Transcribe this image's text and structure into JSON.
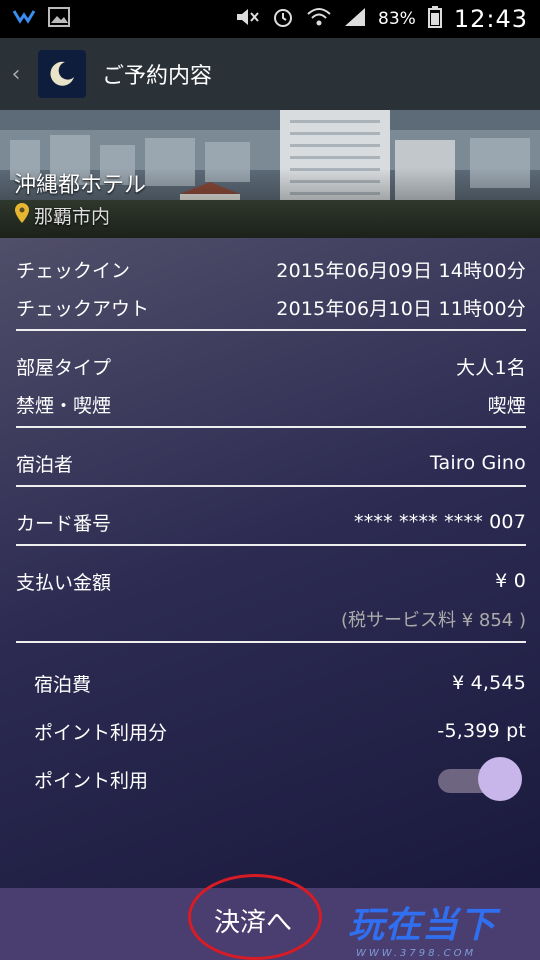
{
  "status_bar": {
    "battery": "83%",
    "time": "12:43"
  },
  "header": {
    "back_glyph": "‹",
    "title": "ご予約内容"
  },
  "hotel": {
    "name": "沖縄都ホテル",
    "location": "那覇市内"
  },
  "booking": {
    "checkin_label": "チェックイン",
    "checkin_value": "2015年06月09日 14時00分",
    "checkout_label": "チェックアウト",
    "checkout_value": "2015年06月10日 11時00分",
    "room_type_label": "部屋タイプ",
    "room_type_value": "大人1名",
    "smoking_label": "禁煙・喫煙",
    "smoking_value": "喫煙",
    "guest_label": "宿泊者",
    "guest_value": "Tairo Gino",
    "card_label": "カード番号",
    "card_value": "**** **** **** 007",
    "payment_label": "支払い金額",
    "payment_value": "¥ 0",
    "tax_note": "(税サービス料 ¥ 854 )",
    "lodging_fee_label": "宿泊費",
    "lodging_fee_value": "¥ 4,545",
    "points_used_label": "ポイント利用分",
    "points_used_value": "-5,399 pt",
    "use_points_label": "ポイント利用"
  },
  "footer": {
    "pay_button_label": "決済へ"
  },
  "watermark": {
    "main": "玩在当下",
    "sub": "WWW.3798.COM"
  },
  "colors": {
    "accent": "#c8b6ea",
    "footer": "#4a3d6f",
    "mark": "#d81b24"
  }
}
